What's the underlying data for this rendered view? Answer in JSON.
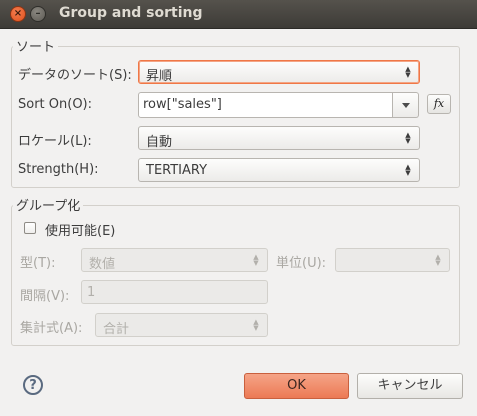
{
  "window": {
    "title": "Group and sorting",
    "close_glyph": "×",
    "minimize_glyph": "–"
  },
  "sort": {
    "section_label": "ソート",
    "direction_label": "データのソート(S):",
    "direction_value": "昇順",
    "sort_on_label": "Sort On(O):",
    "sort_on_value": "row[\"sales\"]",
    "fx_label": "fx",
    "locale_label": "ロケール(L):",
    "locale_value": "自動",
    "strength_label": "Strength(H):",
    "strength_value": "TERTIARY"
  },
  "grouping": {
    "section_label": "グループ化",
    "enable_label": "使用可能(E)",
    "enabled": false,
    "type_label": "型(T):",
    "type_value": "数値",
    "unit_label": "単位(U):",
    "unit_value": "",
    "interval_label": "間隔(V):",
    "interval_value": "1",
    "aggregate_label": "集計式(A):",
    "aggregate_value": "合計"
  },
  "footer": {
    "help_glyph": "?",
    "ok_label": "OK",
    "cancel_label": "キャンセル"
  },
  "colors": {
    "accent": "#ec7a55",
    "titlebar": "#3d3b37",
    "background": "#f2f1f0"
  }
}
